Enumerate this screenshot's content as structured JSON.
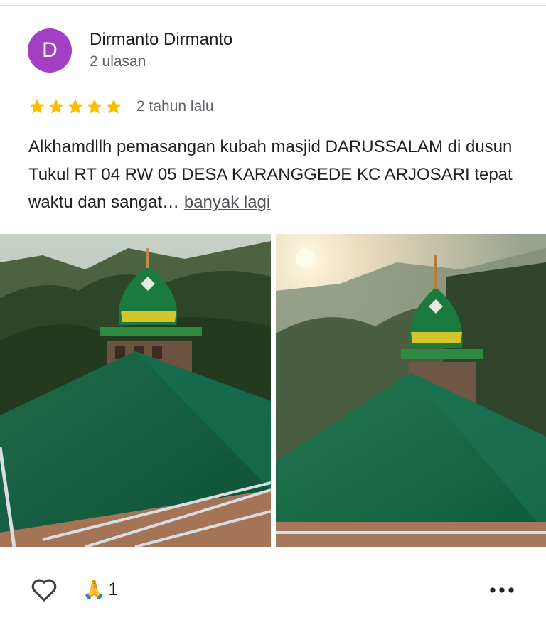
{
  "review": {
    "author": {
      "initial": "D",
      "name": "Dirmanto Dirmanto",
      "review_count": "2 ulasan",
      "avatar_color": "#a23fc4"
    },
    "rating": 5,
    "rating_max": 5,
    "star_color": "#fbbc04",
    "date": "2 tahun lalu",
    "text": "Alkhamdllh pemasangan kubah masjid DARUSSALAM di dusun Tukul RT 04 RW 05 DESA KARANGGEDE KC ARJOSARI tepat waktu dan sangat…",
    "more_label": "banyak lagi",
    "photos": [
      {
        "icon": "photo-mosque-dome-green-roof"
      },
      {
        "icon": "photo-mosque-dome-sunrise"
      }
    ]
  },
  "actions": {
    "like_icon": "heart-outline-icon",
    "reaction_emoji": "🙏",
    "reaction_count": "1",
    "more_icon": "more-horizontal-icon"
  }
}
